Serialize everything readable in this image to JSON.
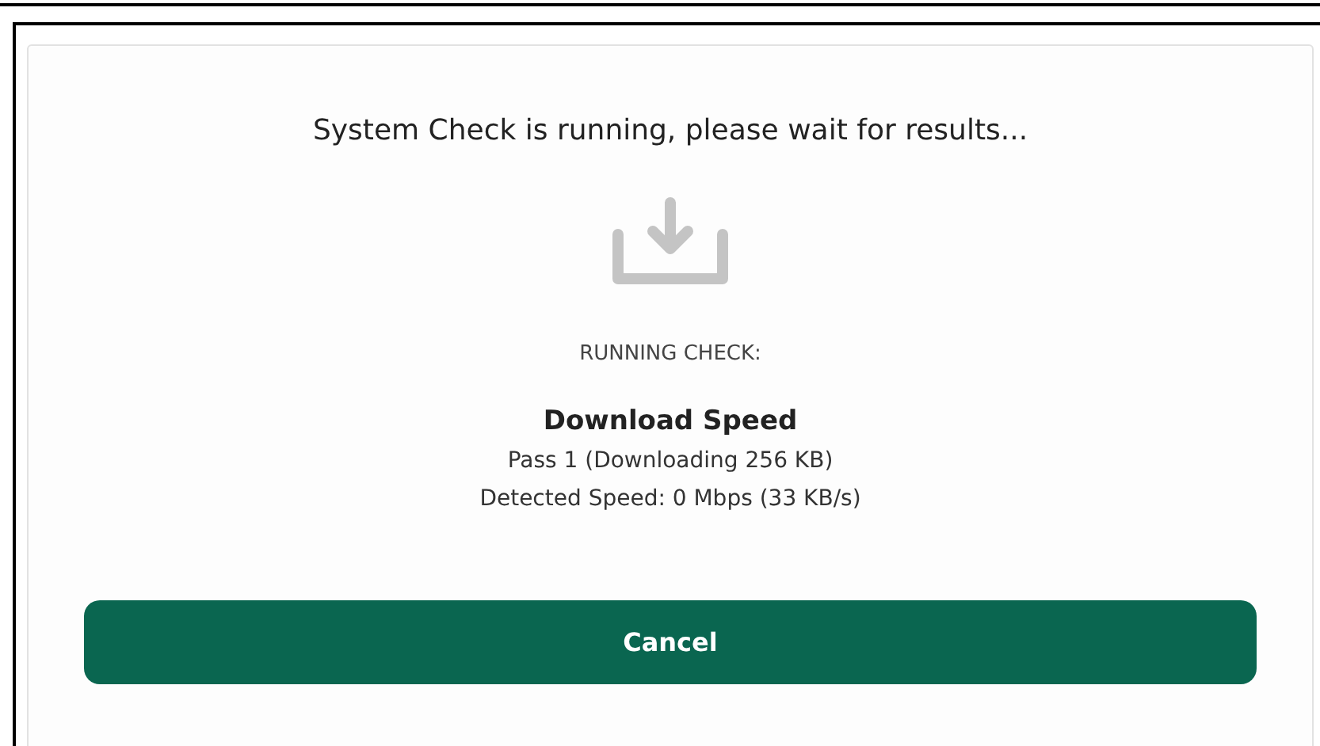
{
  "dialog": {
    "title": "System Check is running, please wait for results...",
    "status_label": "RUNNING CHECK:",
    "check_name": "Download Speed",
    "details": [
      "Pass 1 (Downloading 256 KB)",
      "Detected Speed: 0 Mbps (33 KB/s)"
    ],
    "buttons": [
      "Cancel"
    ]
  }
}
